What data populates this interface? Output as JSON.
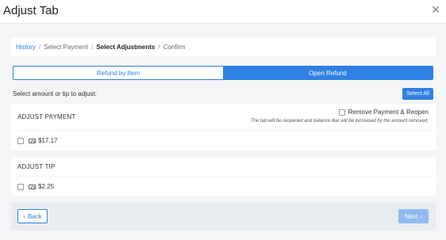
{
  "header": {
    "title": "Adjust Tab",
    "close_icon": "close-icon"
  },
  "breadcrumb": {
    "items": [
      "History",
      "Select Payment",
      "Select Adjustments",
      "Confirm"
    ]
  },
  "segmented": {
    "tabs": [
      "Refund by Item",
      "Open Refund"
    ],
    "active_index": 1
  },
  "select_row": {
    "instruction": "Select amount or tip to adjust:",
    "select_all_label": "Select All"
  },
  "adjust_payment": {
    "title": "ADJUST PAYMENT",
    "remove_label": "Remove Payment & Reopen",
    "remove_note": "The tab will be reopened and balance due will be increased by the amount removed.",
    "amount": "$17.17",
    "icon": "cash-icon"
  },
  "adjust_tip": {
    "title": "ADJUST TIP",
    "amount": "$2.25",
    "icon": "cash-icon"
  },
  "footer": {
    "back_label": "Back",
    "next_label": "Next"
  },
  "colors": {
    "accent": "#2f80e4",
    "accent_disabled": "#8fbaf0"
  }
}
